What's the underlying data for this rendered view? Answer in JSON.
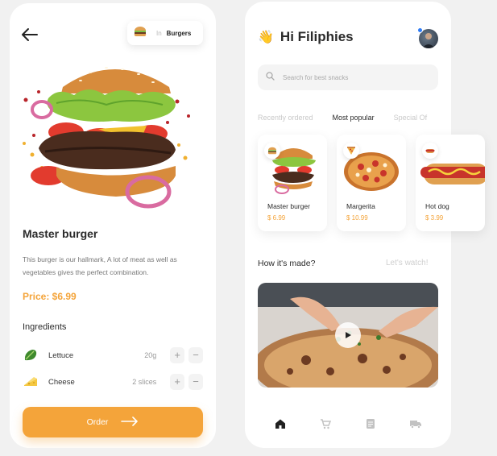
{
  "detail": {
    "category_in": "In",
    "category": "Burgers",
    "title": "Master burger",
    "description": "This burger is our hallmark, A lot of meat as well as vegetables gives the perfect combination.",
    "price": "Price: $6.99",
    "ingredients_heading": "Ingredients",
    "ingredients": [
      {
        "name": "Lettuce",
        "qty": "20g",
        "icon": "lettuce-icon"
      },
      {
        "name": "Cheese",
        "qty": "2 slices",
        "icon": "cheese-icon"
      }
    ],
    "plus": "+",
    "minus": "−",
    "order_label": "Order"
  },
  "home": {
    "greeting": "Hi Filiphies",
    "greeting_emoji": "👋",
    "search_placeholder": "Search for best snacks",
    "tabs": [
      "Recently ordered",
      "Most popular",
      "Special Of"
    ],
    "active_tab": "Most popular",
    "items": [
      {
        "name": "Master burger",
        "price": "$ 6.99",
        "icon": "burger-icon"
      },
      {
        "name": "Margerita",
        "price": "$ 10.99",
        "icon": "pizza-icon"
      },
      {
        "name": "Hot dog",
        "price": "$ 3.99",
        "icon": "hotdog-icon"
      }
    ],
    "section_title": "How it's made?",
    "section_link": "Let's watch!",
    "nav": [
      "home-icon",
      "cart-icon",
      "list-icon",
      "truck-icon"
    ]
  },
  "colors": {
    "accent": "#f4a43a",
    "text": "#2b2b2b",
    "muted": "#999999"
  }
}
